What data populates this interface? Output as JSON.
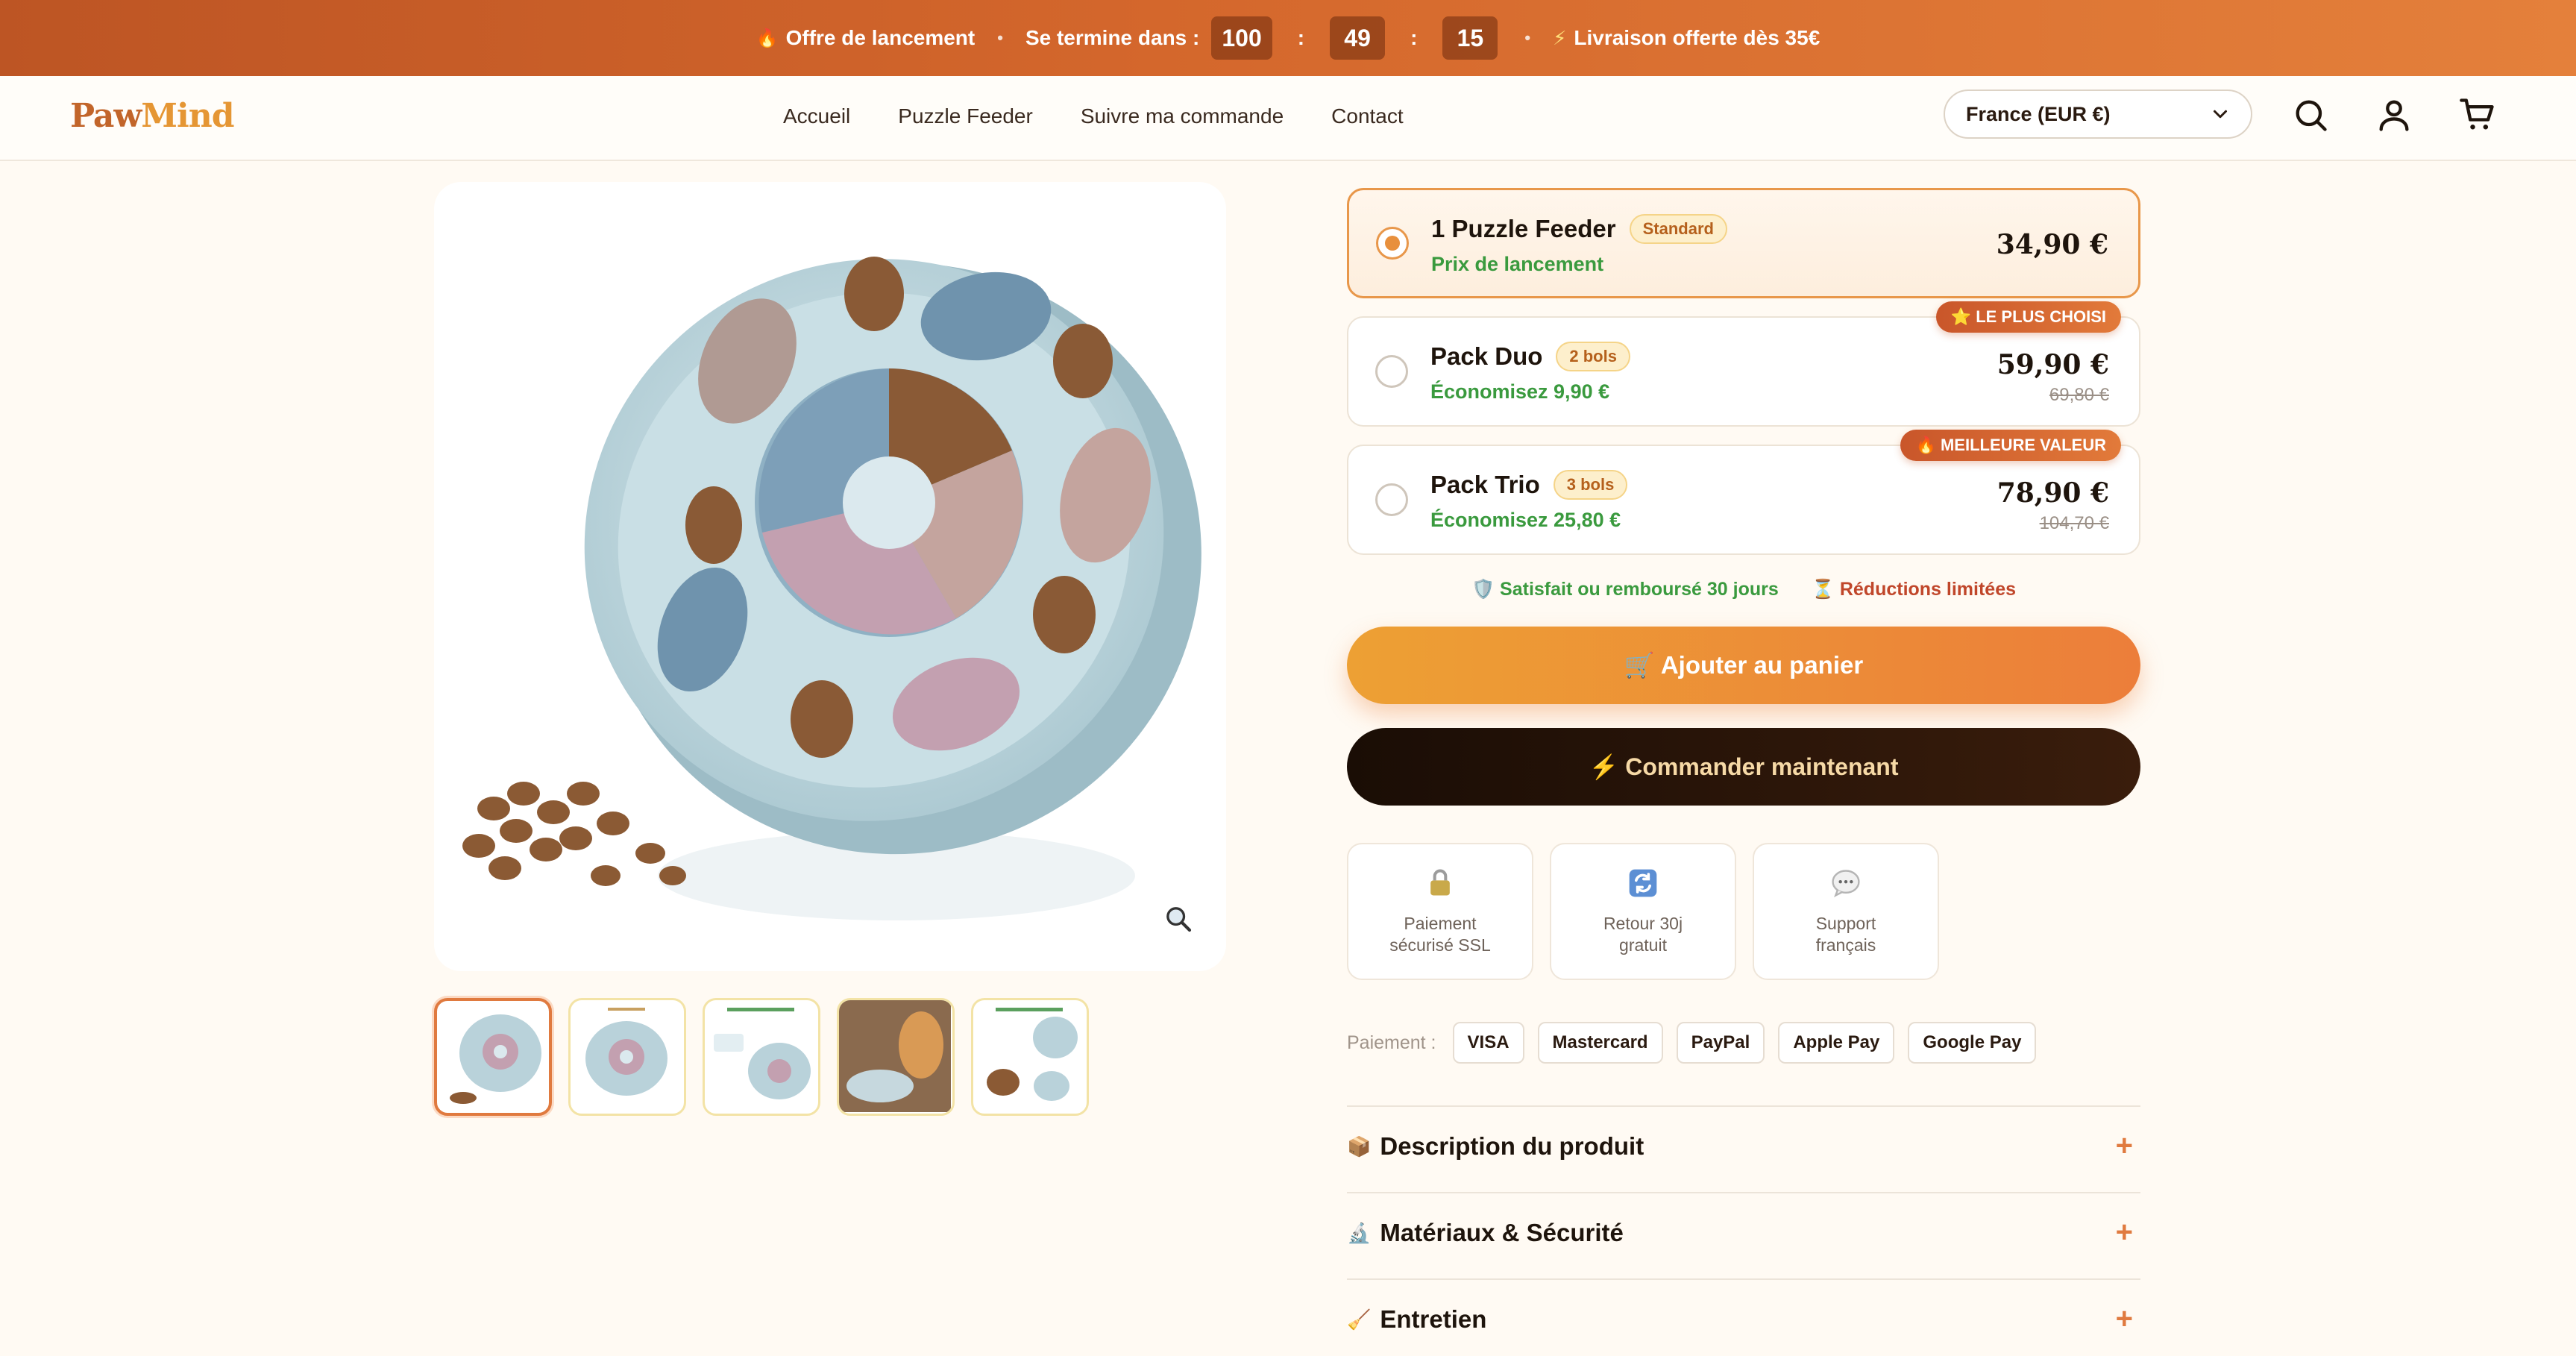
{
  "announcement": {
    "offer_label": "Offre de lancement",
    "ends_label": "Se termine dans :",
    "hours": "100",
    "minutes": "49",
    "seconds": "15",
    "shipping_label": "Livraison offerte dès 35€"
  },
  "header": {
    "logo_part1": "Paw",
    "logo_part2": "Mind",
    "nav": [
      "Accueil",
      "Puzzle Feeder",
      "Suivre ma commande",
      "Contact"
    ],
    "country": "France (EUR €)"
  },
  "offers": [
    {
      "title": "1 Puzzle Feeder",
      "tag": "Standard",
      "subtitle": "Prix de lancement",
      "price": "34,90 €",
      "old_price": "",
      "ribbon": "",
      "selected": true
    },
    {
      "title": "Pack Duo",
      "tag": "2 bols",
      "subtitle": "Économisez 9,90 €",
      "price": "59,90 €",
      "old_price": "69,80 €",
      "ribbon": "LE PLUS CHOISI",
      "selected": false
    },
    {
      "title": "Pack Trio",
      "tag": "3 bols",
      "subtitle": "Économisez 25,80 €",
      "price": "78,90 €",
      "old_price": "104,70 €",
      "ribbon": "MEILLEURE VALEUR",
      "selected": false
    }
  ],
  "guarantees": {
    "refund": "Satisfait ou remboursé 30 jours",
    "limited": "Réductions limitées"
  },
  "buttons": {
    "add_to_cart": "Ajouter au panier",
    "order_now": "Commander maintenant"
  },
  "trust": [
    {
      "label_line1": "Paiement",
      "label_line2": "sécurisé SSL",
      "icon": "lock-icon"
    },
    {
      "label_line1": "Retour 30j",
      "label_line2": "gratuit",
      "icon": "refresh-icon"
    },
    {
      "label_line1": "Support",
      "label_line2": "français",
      "icon": "chat-icon"
    }
  ],
  "payments": {
    "label": "Paiement :",
    "methods": [
      "VISA",
      "Mastercard",
      "PayPal",
      "Apple Pay",
      "Google Pay"
    ]
  },
  "accordion": [
    {
      "title": "Description du produit",
      "icon": "box-icon"
    },
    {
      "title": "Matériaux & Sécurité",
      "icon": "microscope-icon"
    },
    {
      "title": "Entretien",
      "icon": "broom-icon"
    }
  ],
  "colors": {
    "brand_orange": "#e07a3f",
    "banner_start": "#bd5524",
    "banner_end": "#e4803b",
    "success_green": "#3a9a3e",
    "dark_button": "#1a0d05"
  }
}
